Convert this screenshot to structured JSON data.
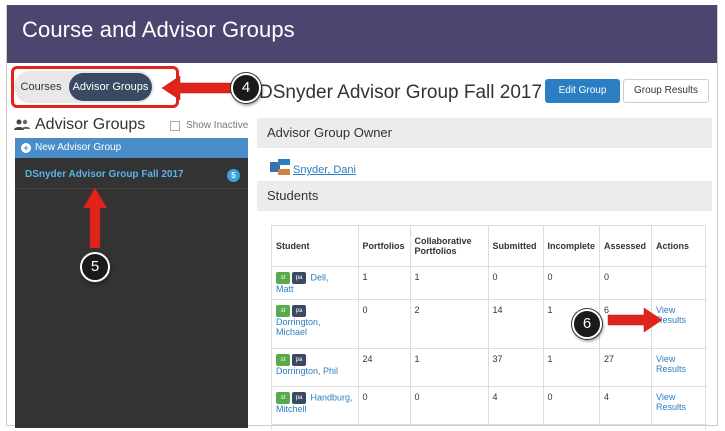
{
  "header": {
    "title": "Course and Advisor Groups"
  },
  "tabs": [
    {
      "label": "Courses",
      "selected": false
    },
    {
      "label": "Advisor Groups",
      "selected": true
    }
  ],
  "sidebar": {
    "title": "Advisor Groups",
    "show_inactive_label": "Show Inactive",
    "new_group_label": "New Advisor Group",
    "groups": [
      {
        "name": "DSnyder Advisor Group Fall 2017",
        "count": "5"
      }
    ]
  },
  "main": {
    "title": "DSnyder Advisor Group Fall 2017",
    "edit_button": "Edit Group",
    "results_button": "Group Results",
    "owner_section": "Advisor Group Owner",
    "owner_name": "Snyder, Dani",
    "students_section": "Students",
    "columns": [
      "Student",
      "Portfolios",
      "Collaborative Portfolios",
      "Submitted",
      "Incomplete",
      "Assessed",
      "Actions"
    ],
    "rows": [
      {
        "name_line1": "Dell,",
        "name_line2": "Matt",
        "portfolios": "1",
        "collab": "1",
        "submitted": "0",
        "incomplete": "0",
        "assessed": "0",
        "action1": "",
        "action2": ""
      },
      {
        "name_line1": "Dorrington,",
        "name_line2": "Michael",
        "portfolios": "0",
        "collab": "2",
        "submitted": "14",
        "incomplete": "1",
        "assessed": "6",
        "action1": "View",
        "action2": "Results"
      },
      {
        "name_line1": "Dorrington, Phil",
        "name_line2": "",
        "portfolios": "24",
        "collab": "1",
        "submitted": "37",
        "incomplete": "1",
        "assessed": "27",
        "action1": "View",
        "action2": "Results"
      },
      {
        "name_line1": "Handburg,",
        "name_line2": "Mitchell",
        "portfolios": "0",
        "collab": "0",
        "submitted": "4",
        "incomplete": "0",
        "assessed": "4",
        "action1": "View",
        "action2": "Results"
      }
    ],
    "chip_st": "st",
    "chip_pa": "pa"
  },
  "annotations": {
    "callout_4": "4",
    "callout_5": "5",
    "callout_6": "6"
  },
  "colors": {
    "header": "#4b466f",
    "accent": "#2b7ec2",
    "annotation": "#e0241b"
  }
}
